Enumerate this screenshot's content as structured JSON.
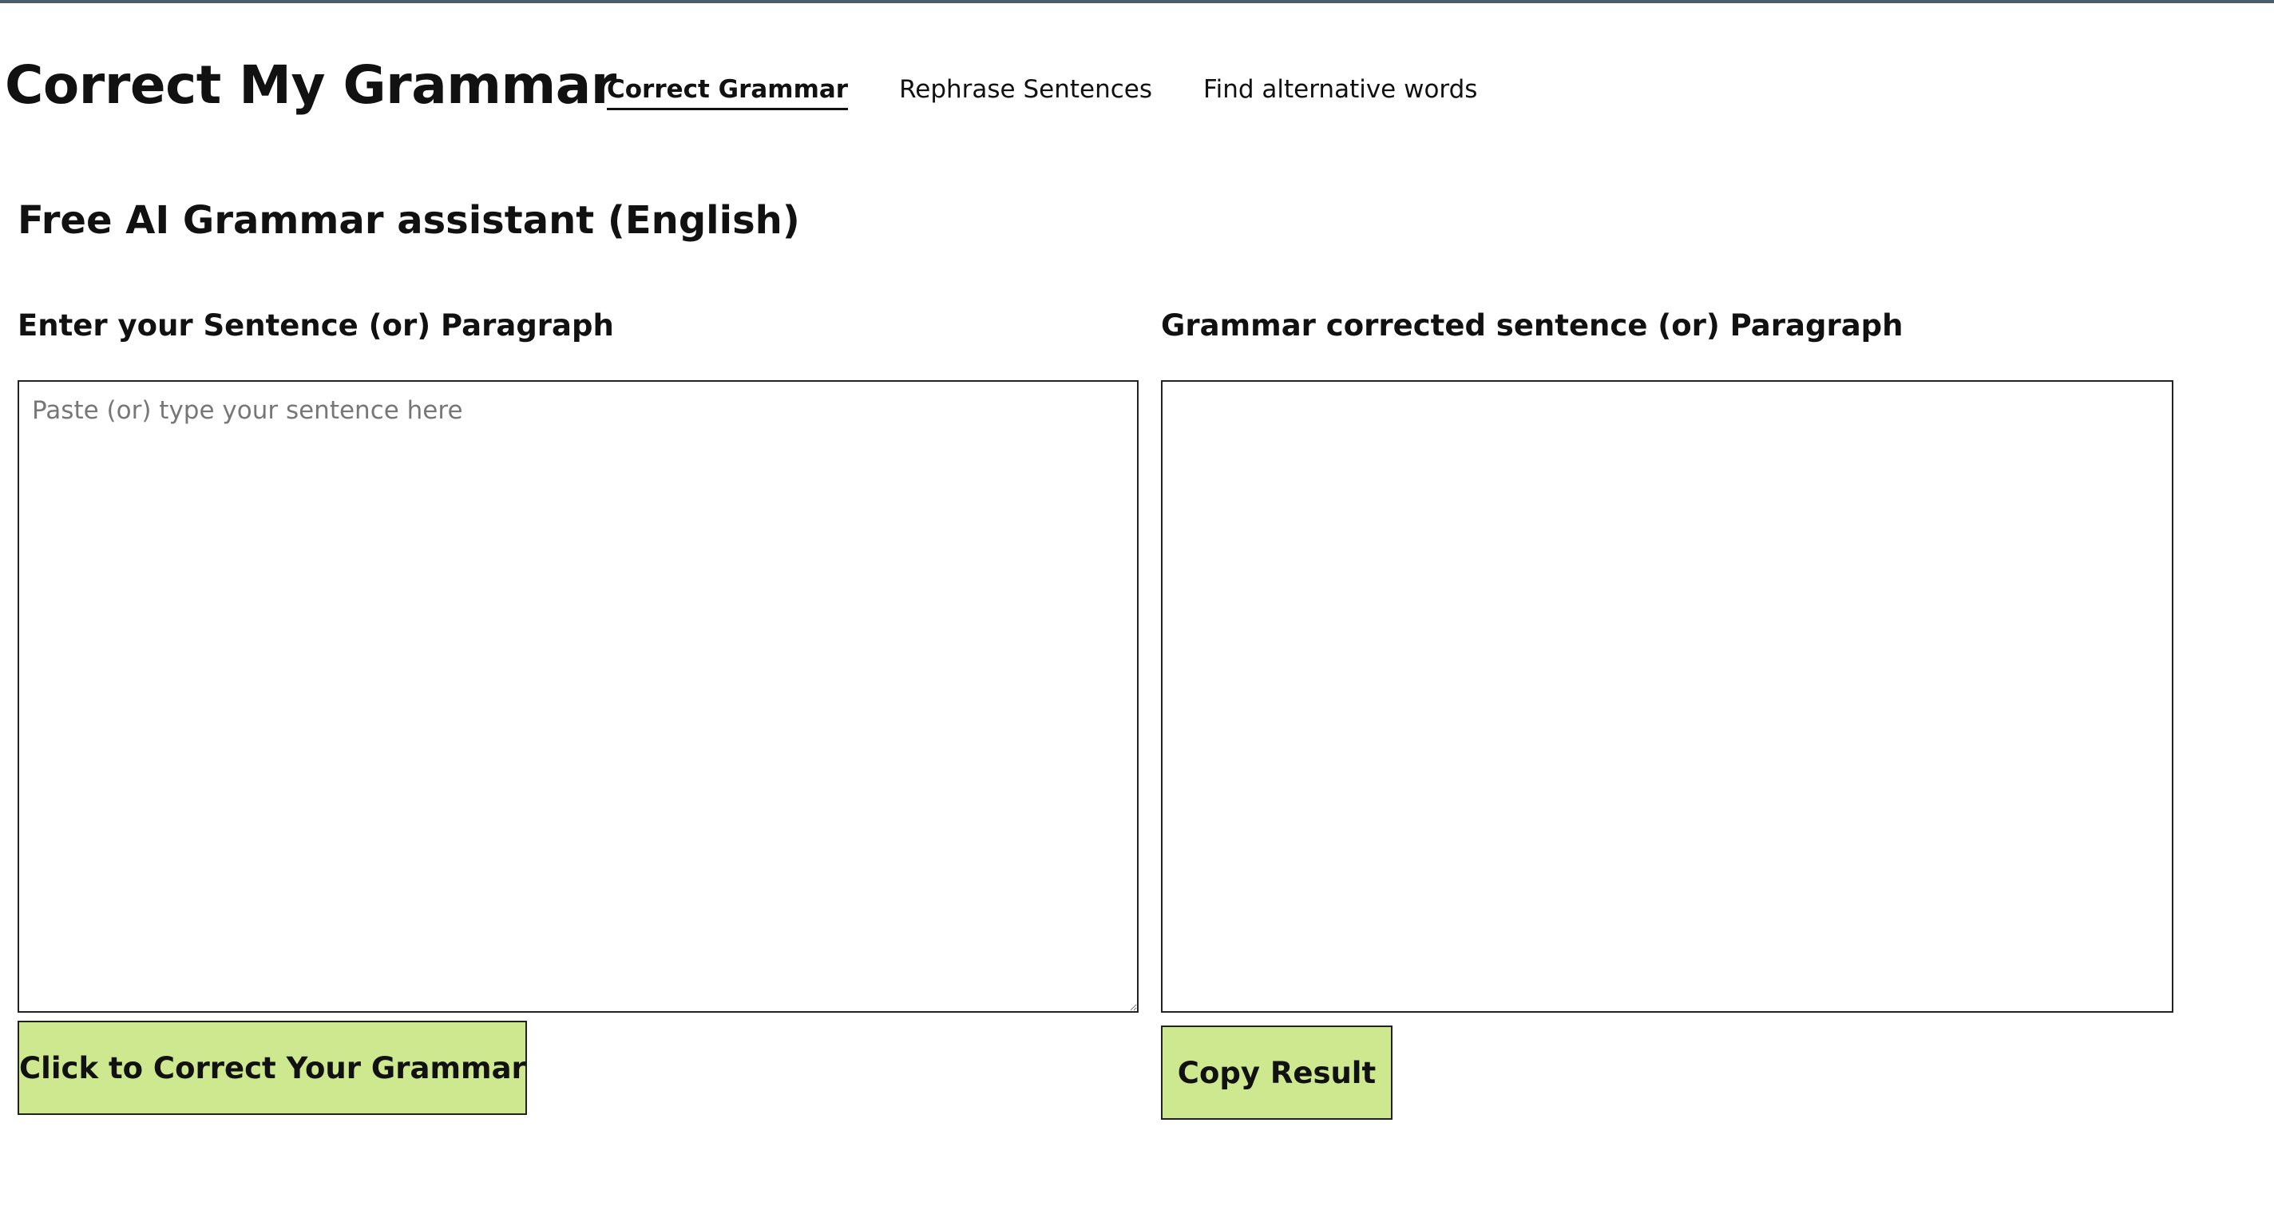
{
  "header": {
    "brand": "Correct My Grammar",
    "nav": [
      {
        "label": "Correct Grammar",
        "active": true
      },
      {
        "label": "Rephrase Sentences",
        "active": false
      },
      {
        "label": "Find alternative words",
        "active": false
      }
    ]
  },
  "main": {
    "title": "Free AI Grammar assistant (English)",
    "input": {
      "label": "Enter your Sentence (or) Paragraph",
      "placeholder": "Paste (or) type your sentence here",
      "value": ""
    },
    "output": {
      "label": "Grammar corrected sentence (or) Paragraph",
      "value": ""
    },
    "correct_button_label": "Click to Correct Your Grammar",
    "copy_button_label": "Copy Result"
  },
  "colors": {
    "button_bg": "#cde88f",
    "top_rule": "#4b5d69",
    "text": "#111111",
    "border": "#222222"
  }
}
